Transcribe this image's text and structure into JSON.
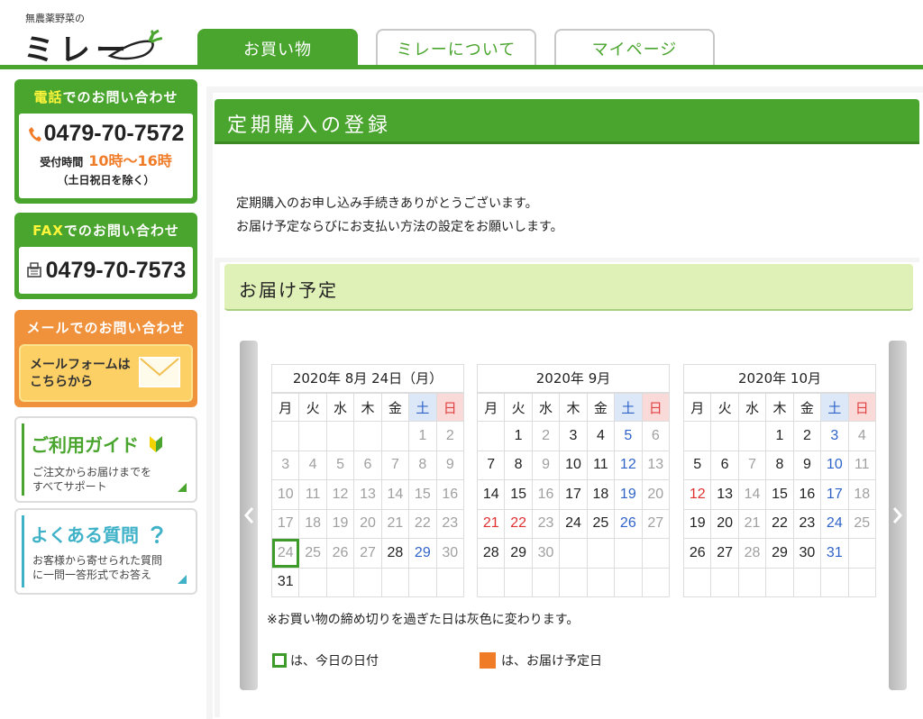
{
  "header": {
    "logo_sub": "無農薬野菜の",
    "logo_main": "ミレー",
    "tabs": [
      {
        "label": "お買い物",
        "active": true
      },
      {
        "label": "ミレーについて",
        "active": false
      },
      {
        "label": "マイページ",
        "active": false
      }
    ]
  },
  "sidebar": {
    "tel": {
      "title_hl": "電話",
      "title_rest": "でのお問い合わせ",
      "number": "0479-70-7572",
      "hours_label": "受付時間",
      "hours": "10時〜16時",
      "note": "（土日祝日を除く）"
    },
    "fax": {
      "title_hl": "FAX",
      "title_rest": "でのお問い合わせ",
      "number": "0479-70-7573"
    },
    "mail": {
      "title": "メールでのお問い合わせ",
      "line1": "メールフォームは",
      "line2": "こちらから"
    },
    "guide": {
      "title": "ご利用ガイド",
      "line1": "ご注文からお届けまでを",
      "line2": "すべてサポート"
    },
    "faq": {
      "title": "よくある質問",
      "line1": "お客様から寄せられた質問",
      "line2": "に一問一答形式でお答え"
    }
  },
  "main": {
    "title": "定期購入の登録",
    "intro_line1": "定期購入のお申し込み手続きありがとうございます。",
    "intro_line2": "お届け予定ならびにお支払い方法の設定をお願いします。",
    "section_title": "お届け予定",
    "note": "※お買い物の締め切りを過ぎた日は灰色に変わります。",
    "legend_today": "は、今日の日付",
    "legend_delivery": "は、お届け予定日",
    "colors": {
      "brand_green": "#4aa52e",
      "delivery_orange": "#f07c28",
      "saturday_blue": "#2f63c8",
      "sunday_red": "#e04040"
    }
  },
  "calendar": {
    "weekdays": [
      "月",
      "火",
      "水",
      "木",
      "金",
      "土",
      "日"
    ],
    "months": [
      {
        "title": "2020年 8月 24日（月）",
        "weeks": [
          [
            "",
            "",
            "",
            "",
            "",
            "1",
            "2"
          ],
          [
            "3",
            "4",
            "5",
            "6",
            "7",
            "8",
            "9"
          ],
          [
            "10",
            "11",
            "12",
            "13",
            "14",
            "15",
            "16"
          ],
          [
            "17",
            "18",
            "19",
            "20",
            "21",
            "22",
            "23"
          ],
          [
            "24",
            "25",
            "26",
            "27",
            "28",
            "29",
            "30"
          ],
          [
            "31",
            "",
            "",
            "",
            "",
            "",
            ""
          ]
        ],
        "past": [
          "1",
          "2",
          "3",
          "4",
          "5",
          "6",
          "7",
          "8",
          "9",
          "10",
          "11",
          "12",
          "13",
          "14",
          "15",
          "16",
          "17",
          "18",
          "19",
          "20",
          "21",
          "22",
          "23",
          "24",
          "25",
          "26",
          "27",
          "30"
        ],
        "blue": [
          "29"
        ],
        "red": [],
        "today": "24"
      },
      {
        "title": "2020年 9月",
        "weeks": [
          [
            "",
            "1",
            "2",
            "3",
            "4",
            "5",
            "6"
          ],
          [
            "7",
            "8",
            "9",
            "10",
            "11",
            "12",
            "13"
          ],
          [
            "14",
            "15",
            "16",
            "17",
            "18",
            "19",
            "20"
          ],
          [
            "21",
            "22",
            "23",
            "24",
            "25",
            "26",
            "27"
          ],
          [
            "28",
            "29",
            "30",
            "",
            "",
            "",
            ""
          ],
          [
            "",
            "",
            "",
            "",
            "",
            "",
            ""
          ]
        ],
        "past": [
          "2",
          "6",
          "9",
          "13",
          "16",
          "20",
          "23",
          "27",
          "30"
        ],
        "blue": [
          "5",
          "12",
          "19",
          "26"
        ],
        "red": [
          "21",
          "22"
        ],
        "today": ""
      },
      {
        "title": "2020年 10月",
        "weeks": [
          [
            "",
            "",
            "",
            "1",
            "2",
            "3",
            "4"
          ],
          [
            "5",
            "6",
            "7",
            "8",
            "9",
            "10",
            "11"
          ],
          [
            "12",
            "13",
            "14",
            "15",
            "16",
            "17",
            "18"
          ],
          [
            "19",
            "20",
            "21",
            "22",
            "23",
            "24",
            "25"
          ],
          [
            "26",
            "27",
            "28",
            "29",
            "30",
            "31",
            ""
          ],
          [
            "",
            "",
            "",
            "",
            "",
            "",
            ""
          ]
        ],
        "past": [
          "4",
          "7",
          "11",
          "14",
          "18",
          "21",
          "25",
          "28"
        ],
        "blue": [
          "3",
          "10",
          "17",
          "24",
          "31"
        ],
        "red": [
          "12"
        ],
        "today": ""
      }
    ]
  }
}
